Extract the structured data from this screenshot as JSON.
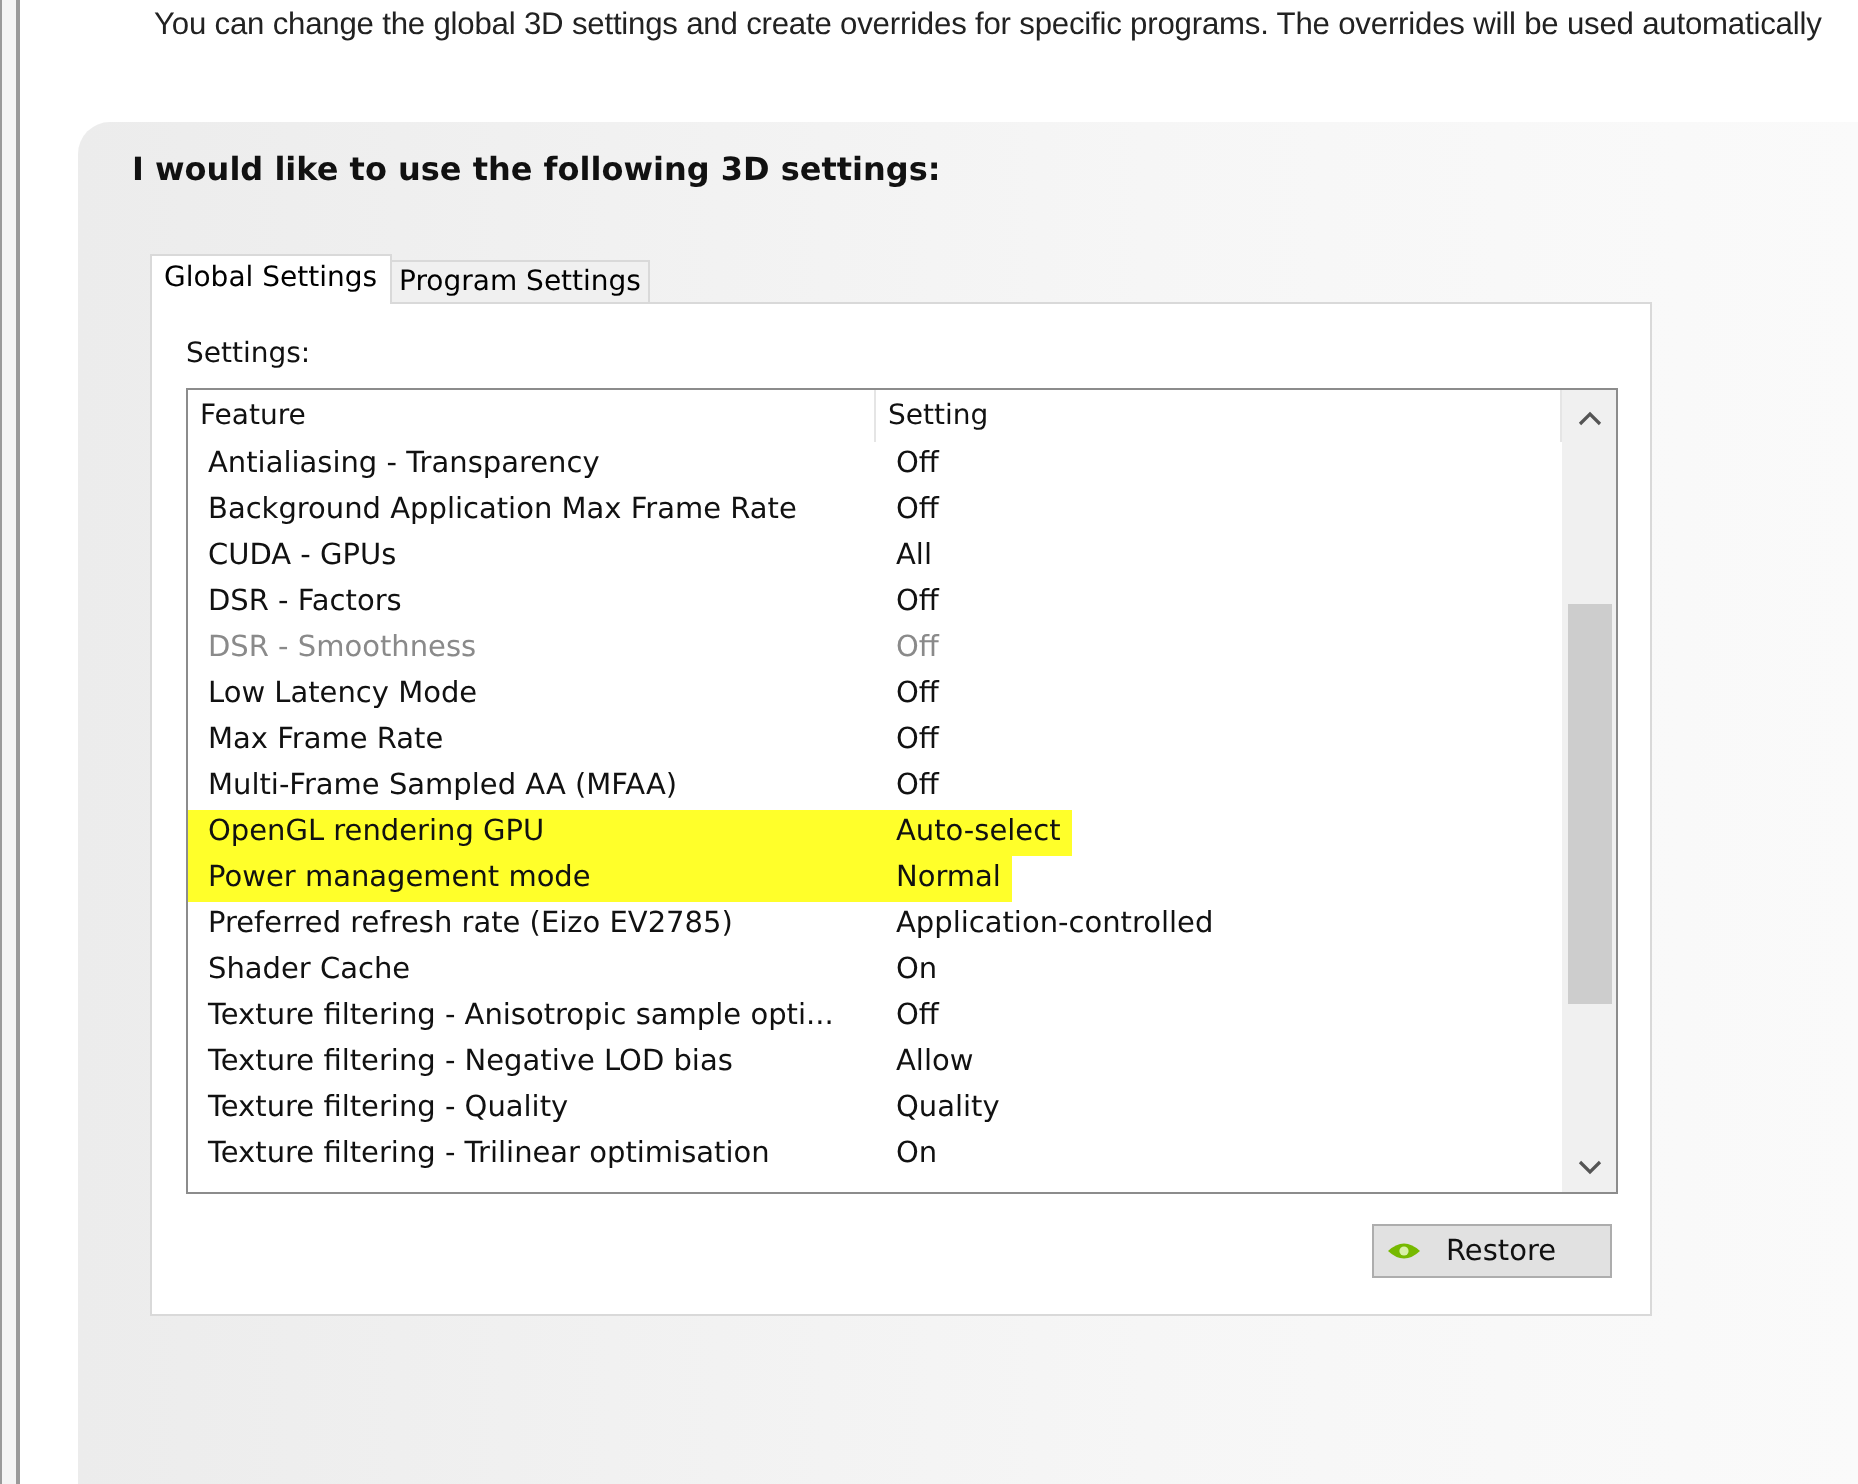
{
  "intro": "You can change the global 3D settings and create overrides for specific programs. The overrides will be used automatically",
  "heading": "I would like to use the following 3D settings:",
  "tabs": [
    {
      "label": "Global Settings",
      "selected": true
    },
    {
      "label": "Program Settings",
      "selected": false
    }
  ],
  "settings_label": "Settings:",
  "table": {
    "columns": [
      "Feature",
      "Setting"
    ],
    "rows": [
      {
        "feature": "Antialiasing - Transparency",
        "setting": "Off",
        "disabled": false,
        "highlighted": false
      },
      {
        "feature": "Background Application Max Frame Rate",
        "setting": "Off",
        "disabled": false,
        "highlighted": false
      },
      {
        "feature": "CUDA - GPUs",
        "setting": "All",
        "disabled": false,
        "highlighted": false
      },
      {
        "feature": "DSR - Factors",
        "setting": "Off",
        "disabled": false,
        "highlighted": false
      },
      {
        "feature": "DSR - Smoothness",
        "setting": "Off",
        "disabled": true,
        "highlighted": false
      },
      {
        "feature": "Low Latency Mode",
        "setting": "Off",
        "disabled": false,
        "highlighted": false
      },
      {
        "feature": "Max Frame Rate",
        "setting": "Off",
        "disabled": false,
        "highlighted": false
      },
      {
        "feature": "Multi-Frame Sampled AA (MFAA)",
        "setting": "Off",
        "disabled": false,
        "highlighted": false
      },
      {
        "feature": "OpenGL rendering GPU",
        "setting": "Auto-select",
        "disabled": false,
        "highlighted": true
      },
      {
        "feature": "Power management mode",
        "setting": "Normal",
        "disabled": false,
        "highlighted": true
      },
      {
        "feature": "Preferred refresh rate (Eizo EV2785)",
        "setting": "Application-controlled",
        "disabled": false,
        "highlighted": false
      },
      {
        "feature": "Shader Cache",
        "setting": "On",
        "disabled": false,
        "highlighted": false
      },
      {
        "feature": "Texture filtering - Anisotropic sample opti...",
        "setting": "Off",
        "disabled": false,
        "highlighted": false
      },
      {
        "feature": "Texture filtering - Negative LOD bias",
        "setting": "Allow",
        "disabled": false,
        "highlighted": false
      },
      {
        "feature": "Texture filtering - Quality",
        "setting": "Quality",
        "disabled": false,
        "highlighted": false
      },
      {
        "feature": "Texture filtering - Trilinear optimisation",
        "setting": "On",
        "disabled": false,
        "highlighted": false
      }
    ]
  },
  "restore_button": "Restore"
}
